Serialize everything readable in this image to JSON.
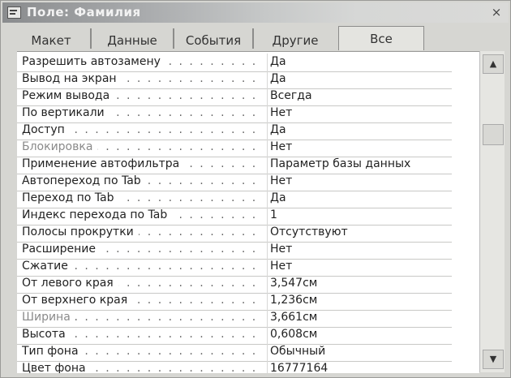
{
  "window": {
    "title": "Поле: Фамилия",
    "close_symbol": "×"
  },
  "tabs": [
    {
      "label": "Макет"
    },
    {
      "label": "Данные"
    },
    {
      "label": "События"
    },
    {
      "label": "Другие"
    },
    {
      "label": "Все",
      "active": true
    }
  ],
  "rows": [
    {
      "name": "Разрешить автозамену",
      "value": "Да"
    },
    {
      "name": "Вывод на экран",
      "value": "Да"
    },
    {
      "name": "Режим вывода",
      "value": "Всегда"
    },
    {
      "name": "По вертикали",
      "value": "Нет"
    },
    {
      "name": "Доступ",
      "value": "Да"
    },
    {
      "name": "Блокировка",
      "value": "Нет"
    },
    {
      "name": "Применение автофильтра",
      "value": "Параметр базы данных"
    },
    {
      "name": "Автопереход по Tab",
      "value": "Нет"
    },
    {
      "name": "Переход по Tab",
      "value": "Да"
    },
    {
      "name": "Индекс перехода по Tab",
      "value": "1"
    },
    {
      "name": "Полосы прокрутки",
      "value": "Отсутствуют"
    },
    {
      "name": "Расширение",
      "value": "Нет"
    },
    {
      "name": "Сжатие",
      "value": "Нет"
    },
    {
      "name": "От левого края",
      "value": "3,547см"
    },
    {
      "name": "От верхнего края",
      "value": "1,236см"
    },
    {
      "name": "Ширина",
      "value": "3,661см"
    },
    {
      "name": "Высота",
      "value": "0,608см"
    },
    {
      "name": "Тип фона",
      "value": "Обычный"
    },
    {
      "name": "Цвет фона",
      "value": "16777164"
    }
  ],
  "scrollbar": {
    "up_symbol": "▲",
    "down_symbol": "▼"
  }
}
